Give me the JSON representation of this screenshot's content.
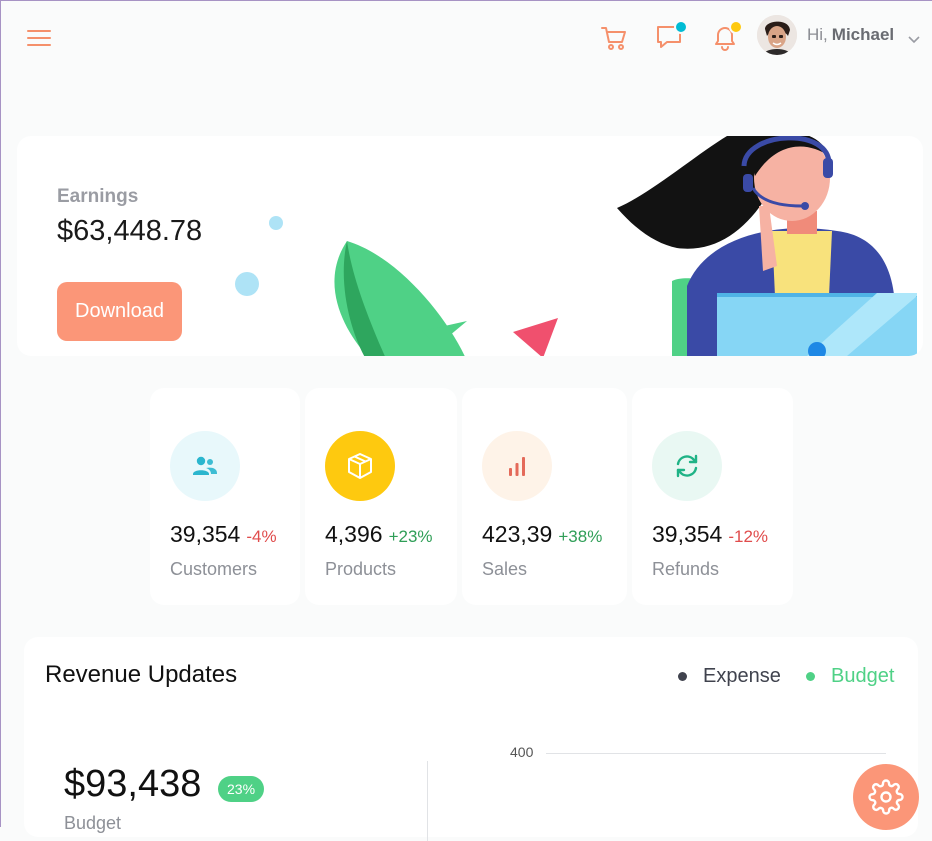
{
  "header": {
    "greeting": "Hi,",
    "user_name": "Michael",
    "icons": [
      "menu-icon",
      "cart-icon",
      "chat-icon",
      "bell-icon",
      "chevron-down-icon"
    ],
    "chat_dot_color": "#00bcd4",
    "bell_dot_color": "#fec90f"
  },
  "earnings": {
    "label": "Earnings",
    "value": "$63,448.78",
    "button_label": "Download"
  },
  "stats": [
    {
      "value": "39,354",
      "change": "-4%",
      "label": "Customers",
      "icon": "users-icon",
      "color": "#2bb6ce",
      "bg": "#e8f8fb"
    },
    {
      "value": "4,396",
      "change": "+23%",
      "label": "Products",
      "icon": "box-icon",
      "color": "#ffffff",
      "bg": "#fec90f"
    },
    {
      "value": "423,39",
      "change": "+38%",
      "label": "Sales",
      "icon": "bar-chart-icon",
      "color": "#e46a5a",
      "bg": "#fef3e8"
    },
    {
      "value": "39,354",
      "change": "-12%",
      "label": "Refunds",
      "icon": "refresh-icon",
      "color": "#1fb386",
      "bg": "#e9f8f3"
    }
  ],
  "revenue": {
    "title": "Revenue Updates",
    "legend": [
      {
        "name": "Expense",
        "color": "#40434e"
      },
      {
        "name": "Budget",
        "color": "#4fd186"
      }
    ],
    "budget_value": "$93,438",
    "budget_change": "23%",
    "budget_label": "Budget",
    "axis_tick": "400"
  },
  "colors": {
    "accent": "#fb9678"
  }
}
